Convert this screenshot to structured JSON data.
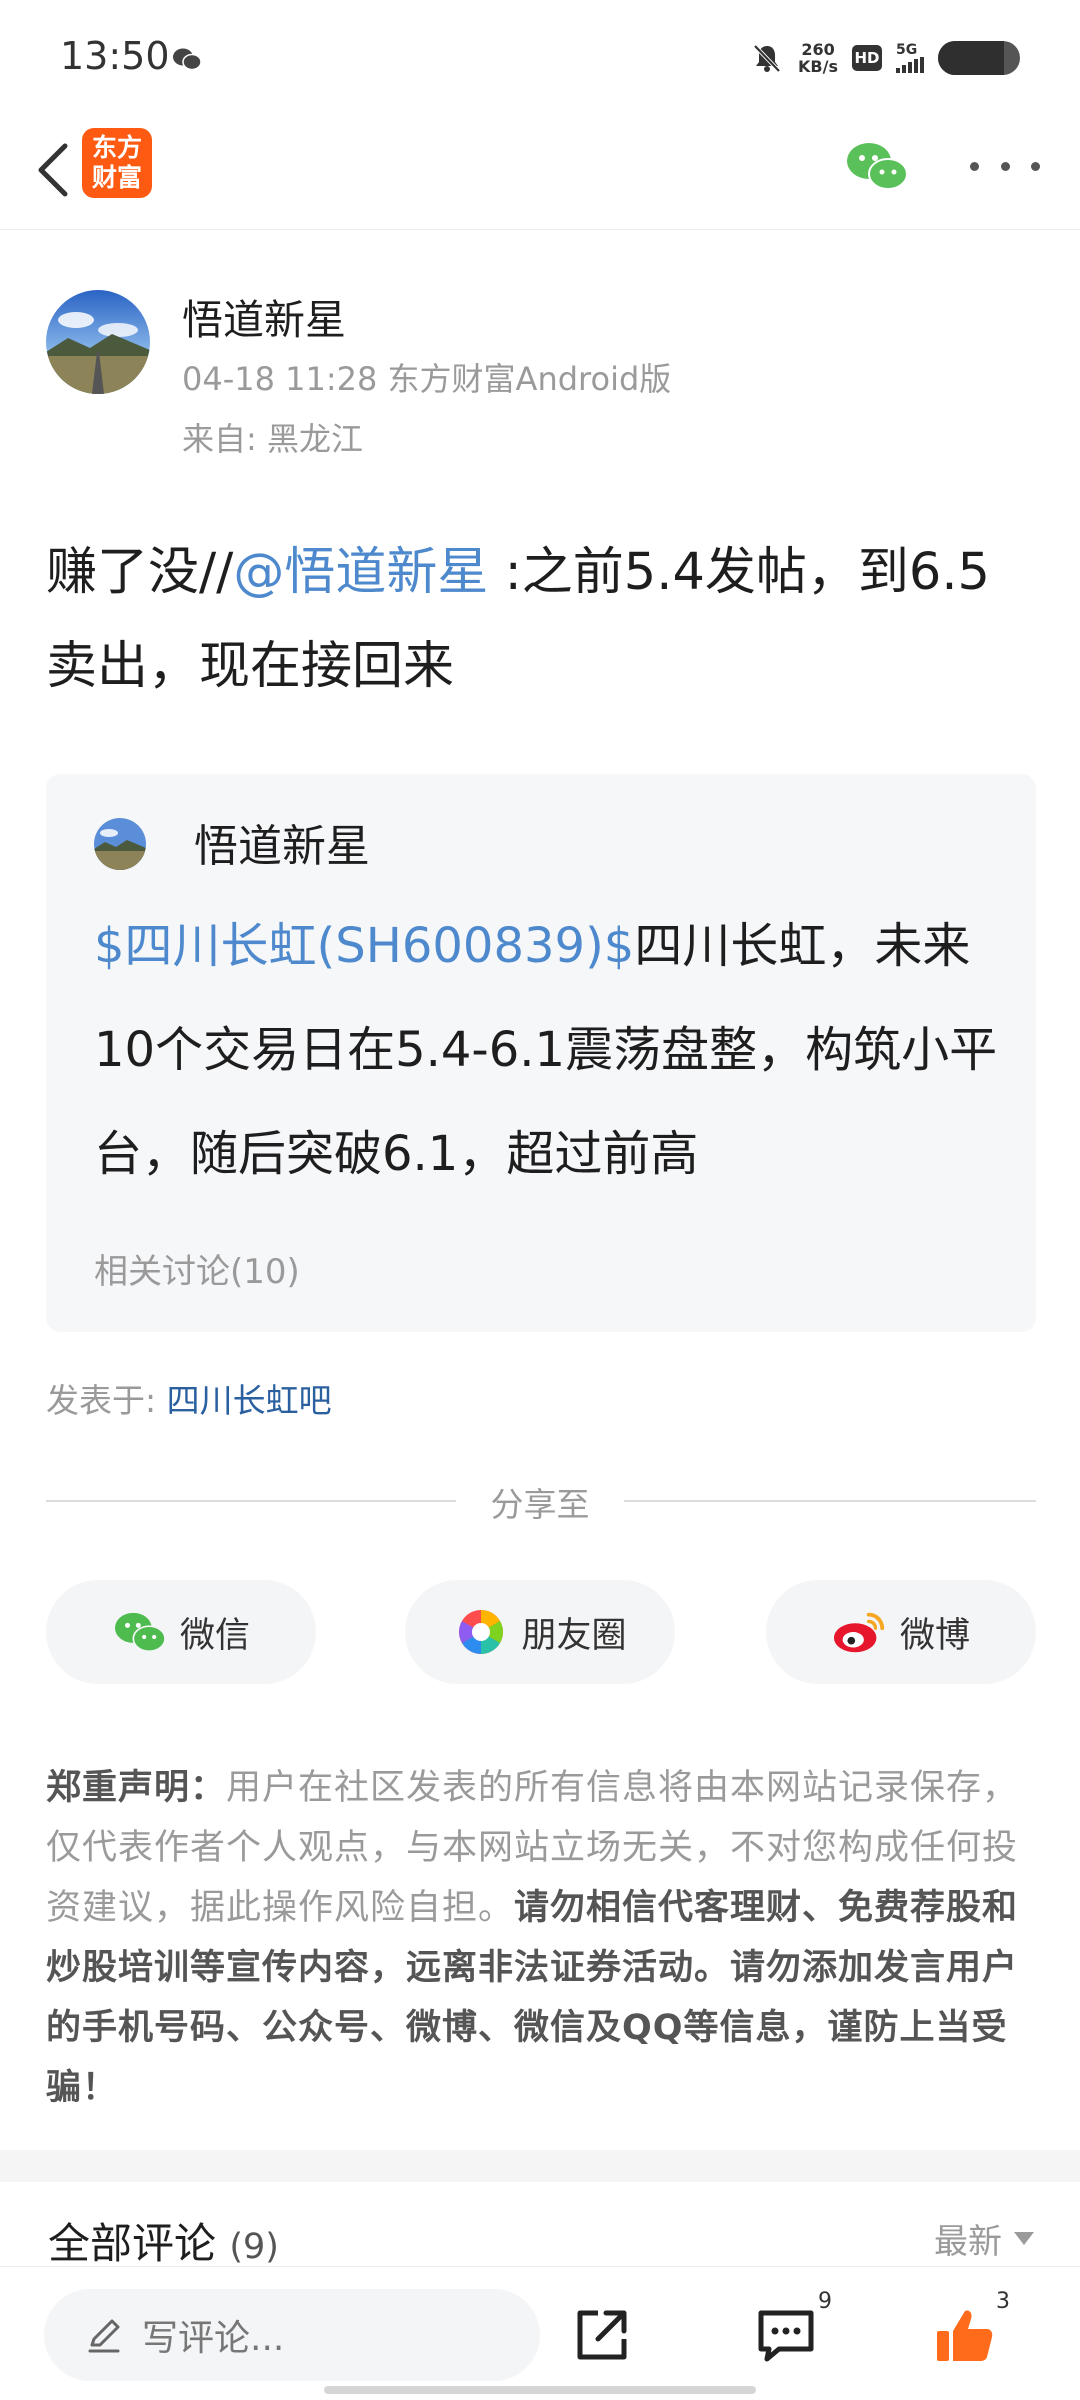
{
  "status_bar": {
    "time": "13:50",
    "net_speed_value": "260",
    "net_speed_unit": "KB/s",
    "hd": "HD",
    "network": "5G",
    "battery_level": 0.8
  },
  "header": {
    "logo_line1": "东方",
    "logo_line2": "财富"
  },
  "post": {
    "author": "悟道新星",
    "meta": "04-18 11:28 东方财富Android版",
    "location": "来自: 黑龙江",
    "body_prefix": "赚了没//",
    "mention": "@悟道新星",
    "body_suffix": " :之前5.4发帖，到6.5卖出，现在接回来"
  },
  "quote": {
    "author": "悟道新星",
    "stock": "$四川长虹(SH600839)$",
    "body": "四川长虹，未来10个交易日在5.4-6.1震荡盘整，构筑小平台，随后突破6.1，超过前高",
    "related": "相关讨论(10)"
  },
  "posted_in": {
    "label": "发表于: ",
    "forum": "四川长虹吧"
  },
  "share": {
    "title": "分享至",
    "wechat": "微信",
    "moments": "朋友圈",
    "weibo": "微博"
  },
  "disclaimer": {
    "title": "郑重声明：",
    "normal": "用户在社区发表的所有信息将由本网站记录保存，仅代表作者个人观点，与本网站立场无关，不对您构成任何投资建议，据此操作风险自担。",
    "strong": "请勿相信代客理财、免费荐股和炒股培训等宣传内容，远离非法证券活动。请勿添加发言用户的手机号码、公众号、微博、微信及QQ等信息，谨防上当受骗！"
  },
  "comments": {
    "title": "全部评论",
    "count": "(9)",
    "sort": "最新"
  },
  "bottom_bar": {
    "placeholder": "写评论...",
    "comment_badge": "9",
    "like_badge": "3"
  },
  "colors": {
    "link": "#4d89cc",
    "brand": "#ff5a12",
    "like": "#ff6b1a"
  }
}
